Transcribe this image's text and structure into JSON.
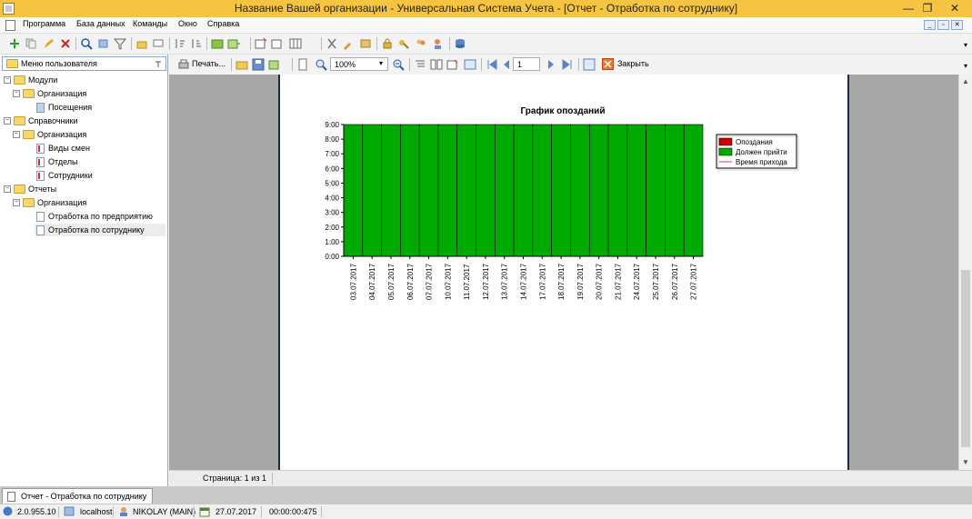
{
  "window": {
    "title": "Название Вашей организации - Универсальная Система Учета - [Отчет - Отработка по сотруднику]",
    "buttons": {
      "minimize": "—",
      "restore": "❐",
      "close": "✕"
    }
  },
  "menu": {
    "items": [
      "Программа",
      "База данных",
      "Команды",
      "Окно",
      "Справка"
    ]
  },
  "sidebar": {
    "header": "Меню пользователя",
    "pin_icon": "pin-icon",
    "tree": [
      {
        "label": "Модули",
        "level": 0,
        "icon": "folder-icon",
        "expanded": true
      },
      {
        "label": "Организация",
        "level": 1,
        "icon": "folder-icon",
        "expanded": true
      },
      {
        "label": "Посещения",
        "level": 2,
        "icon": "document-icon"
      },
      {
        "label": "Справочники",
        "level": 0,
        "icon": "folder-icon",
        "expanded": true
      },
      {
        "label": "Организация",
        "level": 1,
        "icon": "folder-icon",
        "expanded": true
      },
      {
        "label": "Виды смен",
        "level": 2,
        "icon": "list-icon"
      },
      {
        "label": "Отделы",
        "level": 2,
        "icon": "list-icon"
      },
      {
        "label": "Сотрудники",
        "level": 2,
        "icon": "list-icon"
      },
      {
        "label": "Отчеты",
        "level": 0,
        "icon": "folder-icon",
        "expanded": true
      },
      {
        "label": "Организация",
        "level": 1,
        "icon": "folder-icon",
        "expanded": true
      },
      {
        "label": "Отработка по предприятию",
        "level": 2,
        "icon": "report-icon"
      },
      {
        "label": "Отработка по сотруднику",
        "level": 2,
        "icon": "report-icon",
        "selected": true
      }
    ]
  },
  "report_toolbar": {
    "print_label": "Печать...",
    "zoom_value": "100%",
    "page_value": "1",
    "close_label": "Закрыть"
  },
  "report": {
    "page_status": "Страница: 1 из 1"
  },
  "chart_data": {
    "type": "bar",
    "title": "График опозданий",
    "categories": [
      "03.07.2017",
      "04.07.2017",
      "05.07.2017",
      "06.07.2017",
      "07.07.2017",
      "10.07.2017",
      "11.07.2017",
      "12.07.2017",
      "13.07.2017",
      "14.07.2017",
      "17.07.2017",
      "18.07.2017",
      "19.07.2017",
      "20.07.2017",
      "21.07.2017",
      "24.07.2017",
      "25.07.2017",
      "26.07.2017",
      "27.07.2017"
    ],
    "y_ticks": [
      "0:00",
      "1:00",
      "2:00",
      "3:00",
      "4:00",
      "5:00",
      "6:00",
      "7:00",
      "8:00",
      "9:00"
    ],
    "ylim": [
      0,
      9
    ],
    "series": [
      {
        "name": "Опоздания",
        "color": "#cc0000",
        "values": [
          0,
          0,
          0,
          0,
          0,
          0,
          0,
          0,
          0,
          0,
          0,
          0,
          0,
          0,
          0,
          0,
          0,
          0,
          0
        ]
      },
      {
        "name": "Должен прийти",
        "color": "#00aa00",
        "values": [
          9,
          9,
          9,
          9,
          9,
          9,
          9,
          9,
          9,
          9,
          9,
          9,
          9,
          9,
          9,
          9,
          9,
          9,
          9
        ]
      },
      {
        "name": "Время прихода",
        "color": "#cc4444",
        "type": "line",
        "values": [
          0,
          0,
          0,
          0,
          0,
          0,
          0,
          0,
          0,
          0,
          0,
          0,
          0,
          0,
          0,
          0,
          0,
          0,
          0
        ]
      }
    ],
    "legend_position": "right"
  },
  "tabs": {
    "active": "Отчет - Отработка по сотруднику"
  },
  "status": {
    "version": "2.0.955.10",
    "server": "localhost",
    "user": "NIKOLAY (MAIN)",
    "date": "27.07.2017",
    "timer": "00:00:00:475"
  }
}
